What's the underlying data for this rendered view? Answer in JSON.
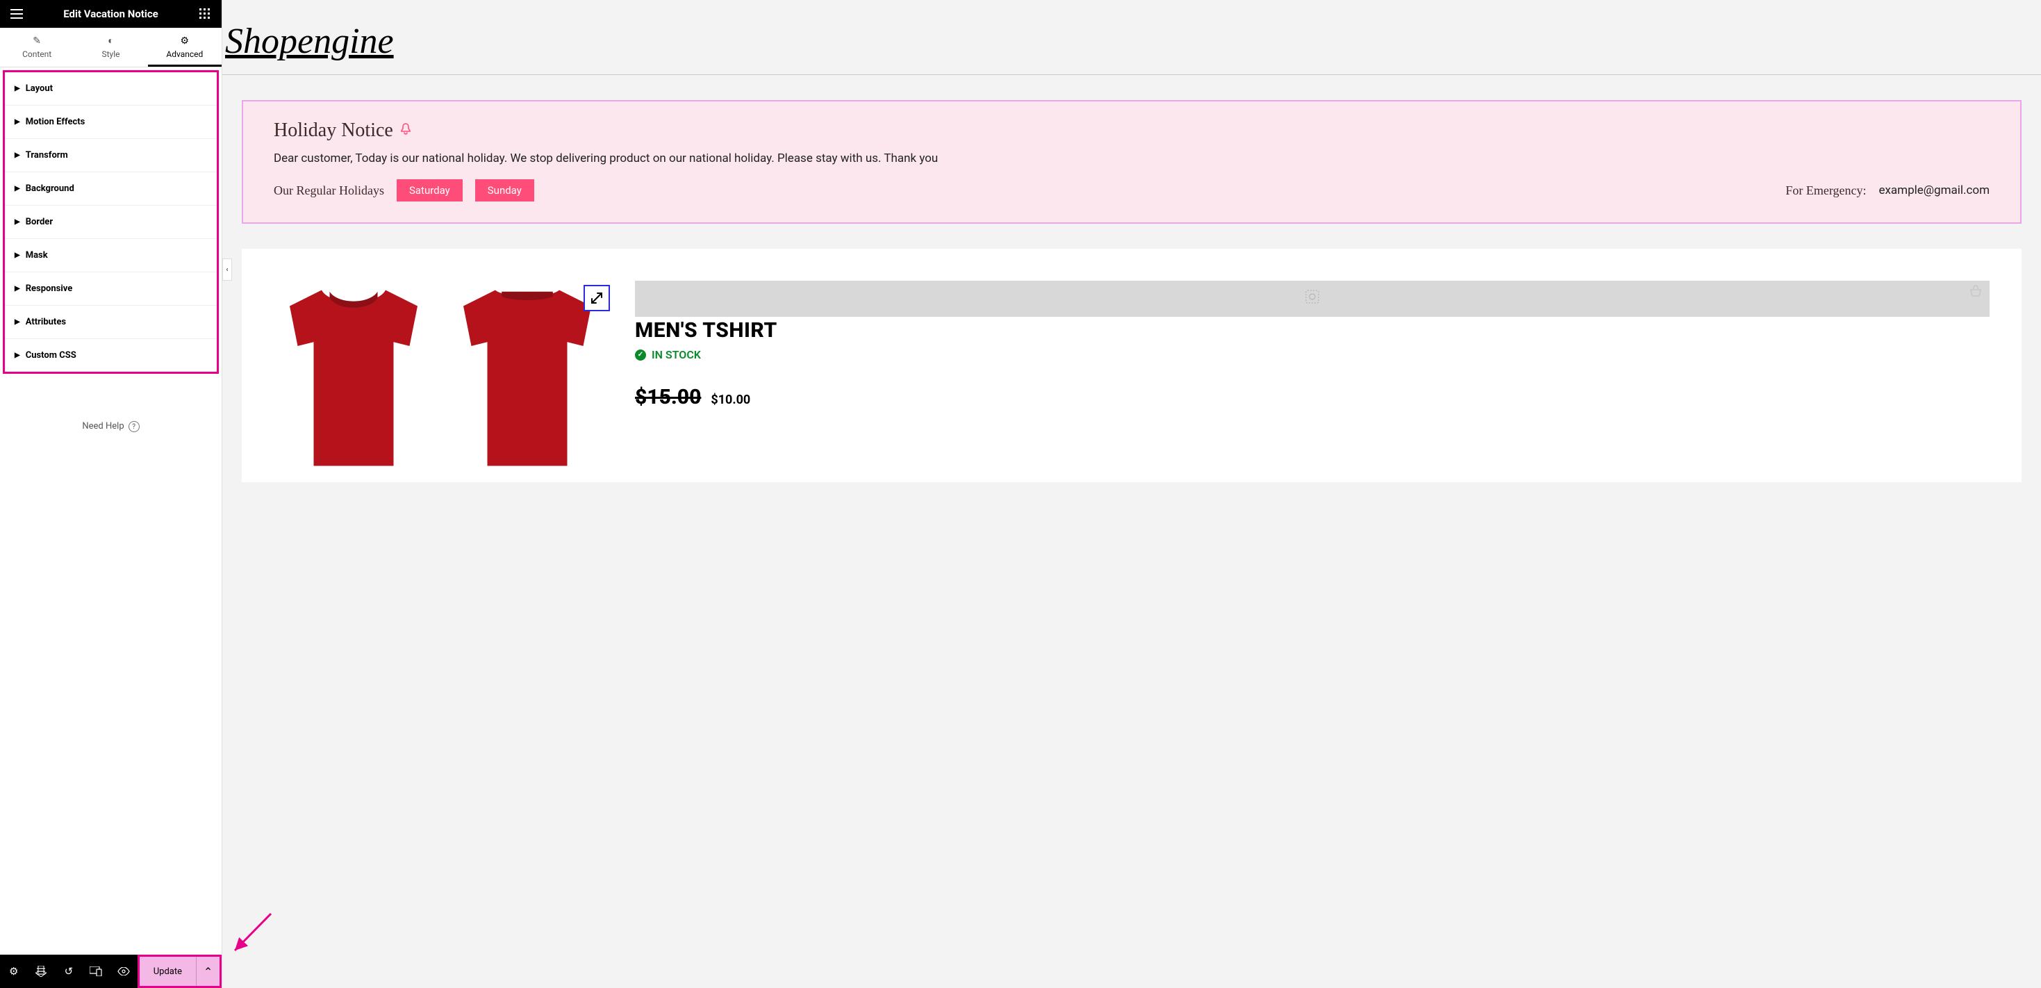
{
  "sidebar": {
    "title": "Edit Vacation Notice",
    "tabs": [
      {
        "label": "Content"
      },
      {
        "label": "Style"
      },
      {
        "label": "Advanced"
      }
    ],
    "sections": [
      {
        "label": "Layout"
      },
      {
        "label": "Motion Effects"
      },
      {
        "label": "Transform"
      },
      {
        "label": "Background"
      },
      {
        "label": "Border"
      },
      {
        "label": "Mask"
      },
      {
        "label": "Responsive"
      },
      {
        "label": "Attributes"
      },
      {
        "label": "Custom CSS"
      }
    ],
    "need_help": "Need Help",
    "update_label": "Update"
  },
  "site": {
    "title": "Shopengine"
  },
  "notice": {
    "title": "Holiday Notice",
    "body": "Dear customer, Today is our national holiday. We stop delivering product on our national holiday. Please stay with us. Thank you",
    "regular_label": "Our Regular Holidays",
    "days": [
      "Saturday",
      "Sunday"
    ],
    "emergency_label": "For Emergency:",
    "emergency_email": "example@gmail.com"
  },
  "product": {
    "name": "MEN'S TSHIRT",
    "stock": "IN STOCK",
    "old_price": "$15.00",
    "new_price": "$10.00"
  }
}
